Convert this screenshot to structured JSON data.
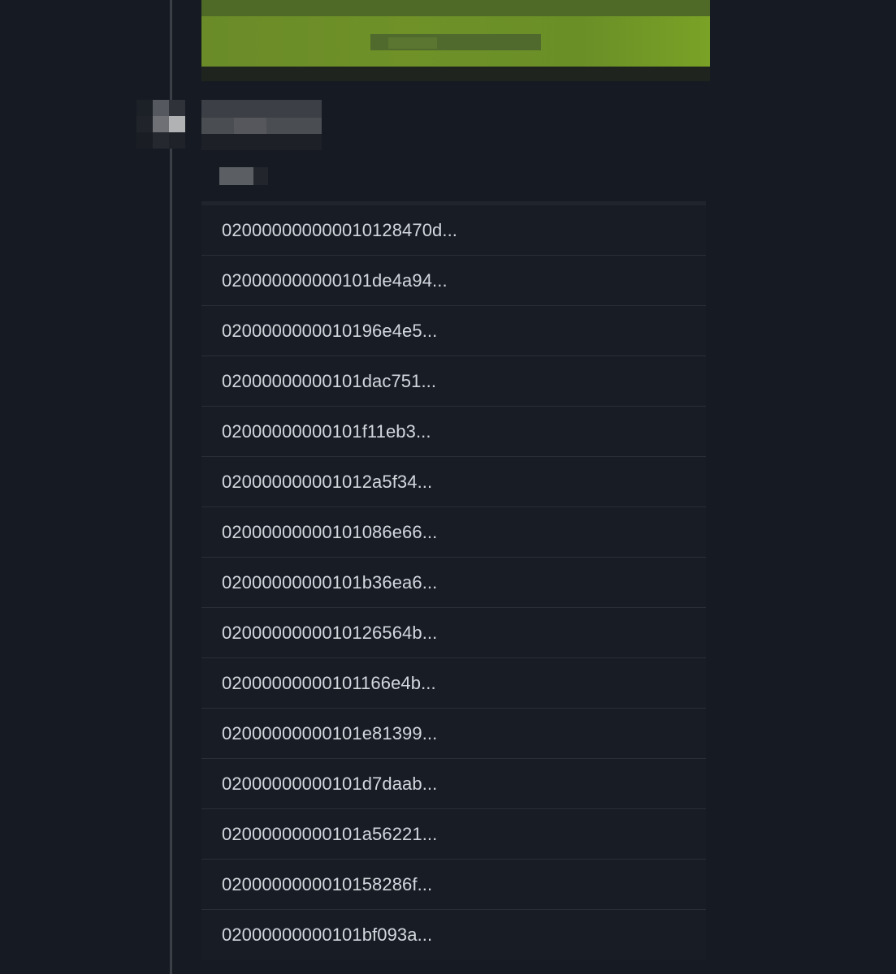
{
  "entries": [
    {
      "id": "020000000000010128470d..."
    },
    {
      "id": "020000000000101de4a94..."
    },
    {
      "id": "0200000000010196e4e5..."
    },
    {
      "id": "02000000000101dac751..."
    },
    {
      "id": "02000000000101f11eb3..."
    },
    {
      "id": "020000000001012a5f34..."
    },
    {
      "id": "02000000000101086e66..."
    },
    {
      "id": "02000000000101b36ea6..."
    },
    {
      "id": "0200000000010126564b..."
    },
    {
      "id": "02000000000101166e4b..."
    },
    {
      "id": "02000000000101e81399..."
    },
    {
      "id": "02000000000101d7daab..."
    },
    {
      "id": "02000000000101a56221..."
    },
    {
      "id": "0200000000010158286f..."
    },
    {
      "id": "02000000000101bf093a..."
    }
  ]
}
